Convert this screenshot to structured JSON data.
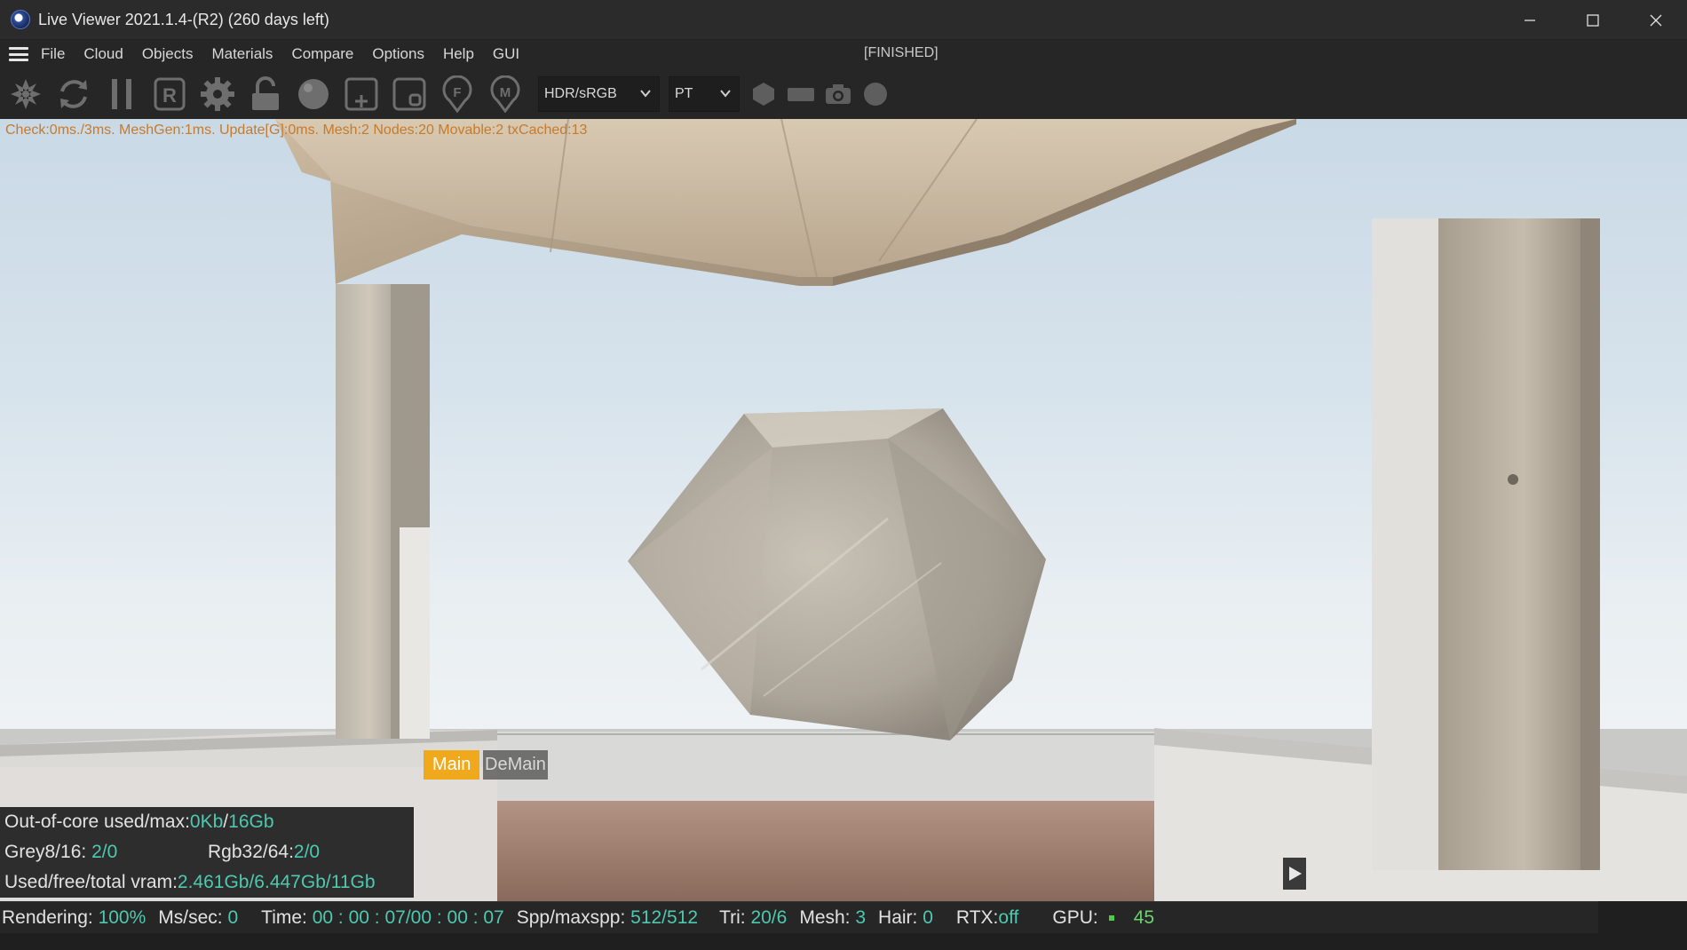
{
  "window": {
    "title": "Live Viewer 2021.1.4-(R2) (260 days left)",
    "controls": [
      "minimize",
      "maximize",
      "close"
    ]
  },
  "menu": {
    "items": [
      "File",
      "Cloud",
      "Objects",
      "Materials",
      "Compare",
      "Options",
      "Help",
      "GUI"
    ],
    "status": "[FINISHED]"
  },
  "toolbar": {
    "icons": [
      "restart-icon",
      "refresh-icon",
      "pause-icon",
      "region-render-icon",
      "settings-gear-icon",
      "lock-icon",
      "material-sphere-icon",
      "add-object-icon",
      "clay-icon",
      "focus-pick-icon",
      "material-pick-icon"
    ],
    "color_mode": "HDR/sRGB",
    "kernel": "PT",
    "right_icons": [
      "hexagon-icon",
      "film-region-icon",
      "camera-icon",
      "circle-icon"
    ]
  },
  "viewport": {
    "debug": "Check:0ms./3ms. MeshGen:1ms. Update[G]:0ms. Mesh:2 Nodes:20 Movable:2 txCached:13"
  },
  "info": {
    "ooc_label": "Out-of-core used/max:",
    "ooc_used": "0Kb",
    "ooc_max": "16Gb",
    "grey_label": "Grey8/16: ",
    "grey_val": "2/0",
    "rgb_label": "Rgb32/64: ",
    "rgb_val": "2/0",
    "vram_label": "Used/free/total vram: ",
    "vram_val": "2.461Gb/6.447Gb/11Gb",
    "tab_main": "Main",
    "tab_demain": "DeMain"
  },
  "status": {
    "rendering_label": "Rendering: ",
    "rendering_val": "100%",
    "mssec_label": "Ms/sec: ",
    "mssec_val": "0",
    "time_label": "Time: ",
    "time_val": "00 : 00 : 07/00 : 00 : 07",
    "spp_label": "Spp/maxspp: ",
    "spp_val": "512/512",
    "tri_label": "Tri: ",
    "tri_val": "20/6",
    "mesh_label": "Mesh: ",
    "mesh_val": "3",
    "hair_label": "Hair: ",
    "hair_val": "0",
    "rtx_label": "RTX:",
    "rtx_val": "off",
    "gpu_label": "GPU:",
    "gpu_val": "45"
  },
  "colors": {
    "accent_value": "#4ec9b0",
    "debug_text": "#c87a2a",
    "active_tab": "#f0a81c"
  }
}
